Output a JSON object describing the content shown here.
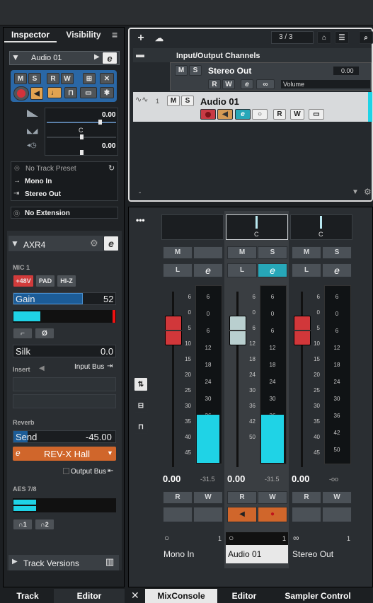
{
  "inspector": {
    "tab_inspector": "Inspector",
    "tab_visibility": "Visibility",
    "track_name": "Audio 01",
    "btn_m": "M",
    "btn_s": "S",
    "btn_r": "R",
    "btn_w": "W",
    "vol_value": "0.00",
    "pan_value": "C",
    "delay_value": "0.00",
    "preset": "No Track Preset",
    "input": "Mono In",
    "output": "Stereo Out",
    "extension": "No Extension",
    "axr_title": "AXR4",
    "mic_label": "MIC 1",
    "p48v": "+48V",
    "pad": "PAD",
    "hiz": "HI-Z",
    "gain_label": "Gain",
    "gain_value": "52",
    "silk_label": "Silk",
    "silk_value": "0.0",
    "insert_label": "Insert",
    "input_bus": "Input Bus",
    "reverb_label": "Reverb",
    "send_label": "Send",
    "send_value": "-45.00",
    "reverb_type": "REV-X Hall",
    "output_bus": "Output Bus",
    "aes": "AES 7/8",
    "hp1": "1",
    "hp2": "2",
    "track_versions": "Track Versions"
  },
  "tracklist": {
    "count": "3 / 3",
    "folder": "Input/Output Channels",
    "stereo_out": "Stereo Out",
    "stereo_value": "0.00",
    "volume_label": "Volume",
    "track_num": "1",
    "audio_name": "Audio 01",
    "bottom_label": "-"
  },
  "mixer": {
    "pan": [
      "C",
      "C"
    ],
    "scale_left": [
      "6",
      "0",
      "5",
      "10",
      "15",
      "20",
      "25",
      "30",
      "35",
      "40",
      "45"
    ],
    "scale_right": [
      "6",
      "0",
      "6",
      "12",
      "18",
      "24",
      "30",
      "36",
      "42",
      "50"
    ],
    "scale_mid": [
      "6",
      "0",
      "6",
      "12",
      "18",
      "24",
      "30",
      "36",
      "42",
      "50"
    ],
    "channels": [
      {
        "vol": "0.00",
        "peak": "-31.5",
        "name": "Mono In",
        "num": "1"
      },
      {
        "vol": "0.00",
        "peak": "-31.5",
        "name": "Audio 01",
        "num": "1"
      },
      {
        "vol": "0.00",
        "peak": "-oo",
        "name": "Stereo Out",
        "num": "1"
      }
    ],
    "btn_m": "M",
    "btn_s": "S",
    "btn_l": "L",
    "btn_r": "R",
    "btn_w": "W"
  },
  "bottom_tabs": {
    "track": "Track",
    "editor": "Editor",
    "mixconsole": "MixConsole",
    "editor2": "Editor",
    "sampler": "Sampler Control"
  },
  "colors": {
    "accent_cyan": "#1fd3e6",
    "record_red": "#d4323a",
    "orange": "#d0662b",
    "fader_red": "#d1373a"
  }
}
